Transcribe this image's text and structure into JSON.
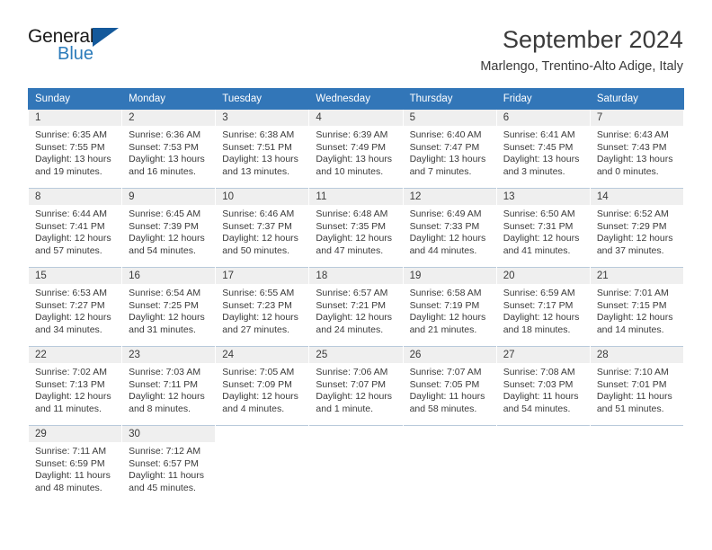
{
  "brand": {
    "name_top": "General",
    "name_bottom": "Blue",
    "triangle_icon": "blue-triangle-logo-icon",
    "color_dark": "#1a1a1a",
    "color_blue": "#2b7bba",
    "color_triangle": "#14599b"
  },
  "header": {
    "title": "September 2024",
    "location": "Marlengo, Trentino-Alto Adige, Italy"
  },
  "theme": {
    "header_row_bg": "#3276b8",
    "header_row_text": "#ffffff",
    "daynum_bg": "#efefef",
    "body_text": "#3a3a3a",
    "row_divider": "#b9cadb"
  },
  "calendar": {
    "weekday_headers": [
      "Sunday",
      "Monday",
      "Tuesday",
      "Wednesday",
      "Thursday",
      "Friday",
      "Saturday"
    ],
    "weeks": [
      [
        {
          "day": "1",
          "sunrise": "Sunrise: 6:35 AM",
          "sunset": "Sunset: 7:55 PM",
          "daylight_line1": "Daylight: 13 hours",
          "daylight_line2": "and 19 minutes."
        },
        {
          "day": "2",
          "sunrise": "Sunrise: 6:36 AM",
          "sunset": "Sunset: 7:53 PM",
          "daylight_line1": "Daylight: 13 hours",
          "daylight_line2": "and 16 minutes."
        },
        {
          "day": "3",
          "sunrise": "Sunrise: 6:38 AM",
          "sunset": "Sunset: 7:51 PM",
          "daylight_line1": "Daylight: 13 hours",
          "daylight_line2": "and 13 minutes."
        },
        {
          "day": "4",
          "sunrise": "Sunrise: 6:39 AM",
          "sunset": "Sunset: 7:49 PM",
          "daylight_line1": "Daylight: 13 hours",
          "daylight_line2": "and 10 minutes."
        },
        {
          "day": "5",
          "sunrise": "Sunrise: 6:40 AM",
          "sunset": "Sunset: 7:47 PM",
          "daylight_line1": "Daylight: 13 hours",
          "daylight_line2": "and 7 minutes."
        },
        {
          "day": "6",
          "sunrise": "Sunrise: 6:41 AM",
          "sunset": "Sunset: 7:45 PM",
          "daylight_line1": "Daylight: 13 hours",
          "daylight_line2": "and 3 minutes."
        },
        {
          "day": "7",
          "sunrise": "Sunrise: 6:43 AM",
          "sunset": "Sunset: 7:43 PM",
          "daylight_line1": "Daylight: 13 hours",
          "daylight_line2": "and 0 minutes."
        }
      ],
      [
        {
          "day": "8",
          "sunrise": "Sunrise: 6:44 AM",
          "sunset": "Sunset: 7:41 PM",
          "daylight_line1": "Daylight: 12 hours",
          "daylight_line2": "and 57 minutes."
        },
        {
          "day": "9",
          "sunrise": "Sunrise: 6:45 AM",
          "sunset": "Sunset: 7:39 PM",
          "daylight_line1": "Daylight: 12 hours",
          "daylight_line2": "and 54 minutes."
        },
        {
          "day": "10",
          "sunrise": "Sunrise: 6:46 AM",
          "sunset": "Sunset: 7:37 PM",
          "daylight_line1": "Daylight: 12 hours",
          "daylight_line2": "and 50 minutes."
        },
        {
          "day": "11",
          "sunrise": "Sunrise: 6:48 AM",
          "sunset": "Sunset: 7:35 PM",
          "daylight_line1": "Daylight: 12 hours",
          "daylight_line2": "and 47 minutes."
        },
        {
          "day": "12",
          "sunrise": "Sunrise: 6:49 AM",
          "sunset": "Sunset: 7:33 PM",
          "daylight_line1": "Daylight: 12 hours",
          "daylight_line2": "and 44 minutes."
        },
        {
          "day": "13",
          "sunrise": "Sunrise: 6:50 AM",
          "sunset": "Sunset: 7:31 PM",
          "daylight_line1": "Daylight: 12 hours",
          "daylight_line2": "and 41 minutes."
        },
        {
          "day": "14",
          "sunrise": "Sunrise: 6:52 AM",
          "sunset": "Sunset: 7:29 PM",
          "daylight_line1": "Daylight: 12 hours",
          "daylight_line2": "and 37 minutes."
        }
      ],
      [
        {
          "day": "15",
          "sunrise": "Sunrise: 6:53 AM",
          "sunset": "Sunset: 7:27 PM",
          "daylight_line1": "Daylight: 12 hours",
          "daylight_line2": "and 34 minutes."
        },
        {
          "day": "16",
          "sunrise": "Sunrise: 6:54 AM",
          "sunset": "Sunset: 7:25 PM",
          "daylight_line1": "Daylight: 12 hours",
          "daylight_line2": "and 31 minutes."
        },
        {
          "day": "17",
          "sunrise": "Sunrise: 6:55 AM",
          "sunset": "Sunset: 7:23 PM",
          "daylight_line1": "Daylight: 12 hours",
          "daylight_line2": "and 27 minutes."
        },
        {
          "day": "18",
          "sunrise": "Sunrise: 6:57 AM",
          "sunset": "Sunset: 7:21 PM",
          "daylight_line1": "Daylight: 12 hours",
          "daylight_line2": "and 24 minutes."
        },
        {
          "day": "19",
          "sunrise": "Sunrise: 6:58 AM",
          "sunset": "Sunset: 7:19 PM",
          "daylight_line1": "Daylight: 12 hours",
          "daylight_line2": "and 21 minutes."
        },
        {
          "day": "20",
          "sunrise": "Sunrise: 6:59 AM",
          "sunset": "Sunset: 7:17 PM",
          "daylight_line1": "Daylight: 12 hours",
          "daylight_line2": "and 18 minutes."
        },
        {
          "day": "21",
          "sunrise": "Sunrise: 7:01 AM",
          "sunset": "Sunset: 7:15 PM",
          "daylight_line1": "Daylight: 12 hours",
          "daylight_line2": "and 14 minutes."
        }
      ],
      [
        {
          "day": "22",
          "sunrise": "Sunrise: 7:02 AM",
          "sunset": "Sunset: 7:13 PM",
          "daylight_line1": "Daylight: 12 hours",
          "daylight_line2": "and 11 minutes."
        },
        {
          "day": "23",
          "sunrise": "Sunrise: 7:03 AM",
          "sunset": "Sunset: 7:11 PM",
          "daylight_line1": "Daylight: 12 hours",
          "daylight_line2": "and 8 minutes."
        },
        {
          "day": "24",
          "sunrise": "Sunrise: 7:05 AM",
          "sunset": "Sunset: 7:09 PM",
          "daylight_line1": "Daylight: 12 hours",
          "daylight_line2": "and 4 minutes."
        },
        {
          "day": "25",
          "sunrise": "Sunrise: 7:06 AM",
          "sunset": "Sunset: 7:07 PM",
          "daylight_line1": "Daylight: 12 hours",
          "daylight_line2": "and 1 minute."
        },
        {
          "day": "26",
          "sunrise": "Sunrise: 7:07 AM",
          "sunset": "Sunset: 7:05 PM",
          "daylight_line1": "Daylight: 11 hours",
          "daylight_line2": "and 58 minutes."
        },
        {
          "day": "27",
          "sunrise": "Sunrise: 7:08 AM",
          "sunset": "Sunset: 7:03 PM",
          "daylight_line1": "Daylight: 11 hours",
          "daylight_line2": "and 54 minutes."
        },
        {
          "day": "28",
          "sunrise": "Sunrise: 7:10 AM",
          "sunset": "Sunset: 7:01 PM",
          "daylight_line1": "Daylight: 11 hours",
          "daylight_line2": "and 51 minutes."
        }
      ],
      [
        {
          "day": "29",
          "sunrise": "Sunrise: 7:11 AM",
          "sunset": "Sunset: 6:59 PM",
          "daylight_line1": "Daylight: 11 hours",
          "daylight_line2": "and 48 minutes."
        },
        {
          "day": "30",
          "sunrise": "Sunrise: 7:12 AM",
          "sunset": "Sunset: 6:57 PM",
          "daylight_line1": "Daylight: 11 hours",
          "daylight_line2": "and 45 minutes."
        },
        {
          "day": "",
          "sunrise": "",
          "sunset": "",
          "daylight_line1": "",
          "daylight_line2": ""
        },
        {
          "day": "",
          "sunrise": "",
          "sunset": "",
          "daylight_line1": "",
          "daylight_line2": ""
        },
        {
          "day": "",
          "sunrise": "",
          "sunset": "",
          "daylight_line1": "",
          "daylight_line2": ""
        },
        {
          "day": "",
          "sunrise": "",
          "sunset": "",
          "daylight_line1": "",
          "daylight_line2": ""
        },
        {
          "day": "",
          "sunrise": "",
          "sunset": "",
          "daylight_line1": "",
          "daylight_line2": ""
        }
      ]
    ]
  }
}
